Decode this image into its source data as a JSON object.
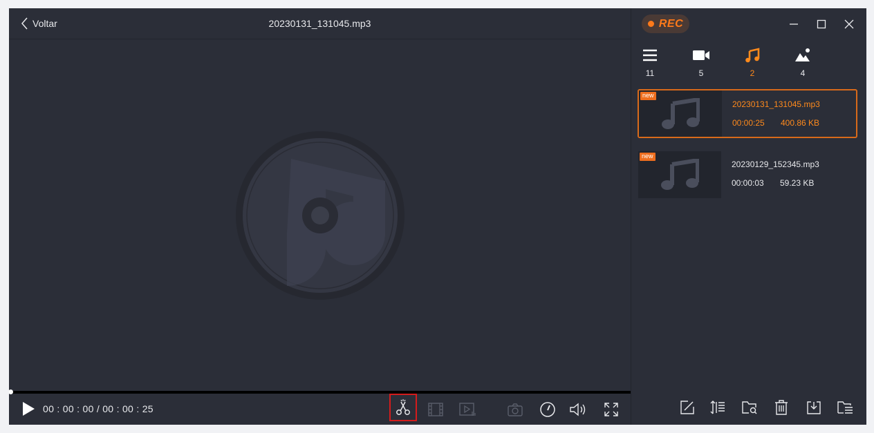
{
  "header": {
    "back_label": "Voltar",
    "file_title": "20230131_131045.mp3",
    "rec_label": "REC"
  },
  "player": {
    "timecode": "00 : 00 : 00 / 00 : 00 : 25",
    "progress": 0
  },
  "sidebar": {
    "categories": [
      {
        "icon": "list-icon",
        "count": "11"
      },
      {
        "icon": "video-icon",
        "count": "5"
      },
      {
        "icon": "music-note-icon",
        "count": "2",
        "active": true
      },
      {
        "icon": "image-icon",
        "count": "4"
      }
    ],
    "files": [
      {
        "badge": "new",
        "name": "20230131_131045.mp3",
        "duration": "00:00:25",
        "size": "400.86 KB",
        "selected": true
      },
      {
        "badge": "new",
        "name": "20230129_152345.mp3",
        "duration": "00:00:03",
        "size": "59.23 KB",
        "selected": false
      }
    ]
  },
  "colors": {
    "accent": "#ff8a1c",
    "background": "#2b2e38",
    "highlight_border": "#d41c1c"
  }
}
